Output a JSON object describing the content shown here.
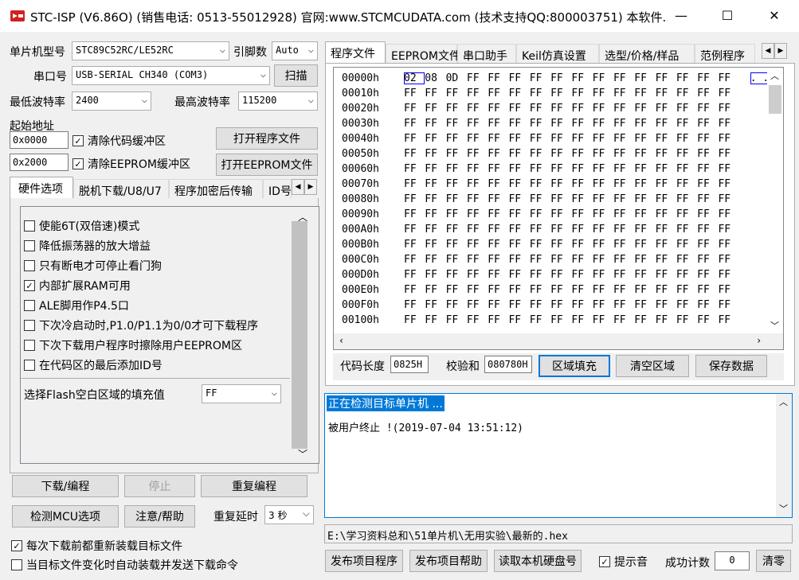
{
  "window": {
    "title": "STC-ISP (V6.86O) (销售电话: 0513-55012928) 官网:www.STCMCUDATA.com  (技术支持QQ:800003751) 本软件...",
    "minimize": "—",
    "maximize": "☐",
    "close": "✕"
  },
  "left": {
    "mcu_label": "单片机型号",
    "mcu_value": "STC89C52RC/LE52RC",
    "pins_label": "引脚数",
    "pins_value": "Auto",
    "port_label": "串口号",
    "port_value": "USB-SERIAL CH340 (COM3)",
    "scan_button": "扫描",
    "min_baud_label": "最低波特率",
    "min_baud_value": "2400",
    "max_baud_label": "最高波特率",
    "max_baud_value": "115200",
    "start_addr_label": "起始地址",
    "code_addr": "0x0000",
    "clear_code_label": "清除代码缓冲区",
    "open_prog_button": "打开程序文件",
    "eeprom_addr": "0x2000",
    "clear_eeprom_label": "清除EEPROM缓冲区",
    "open_eeprom_button": "打开EEPROM文件",
    "tabs": [
      "硬件选项",
      "脱机下载/U8/U7",
      "程序加密后传输",
      "ID号"
    ],
    "options": [
      {
        "label": "使能6T(双倍速)模式",
        "checked": false
      },
      {
        "label": "降低振荡器的放大增益",
        "checked": false
      },
      {
        "label": "只有断电才可停止看门狗",
        "checked": false
      },
      {
        "label": "内部扩展RAM可用",
        "checked": true
      },
      {
        "label": "ALE脚用作P4.5口",
        "checked": false
      },
      {
        "label": "下次冷启动时,P1.0/P1.1为0/0才可下载程序",
        "checked": false
      },
      {
        "label": "下次下载用户程序时擦除用户EEPROM区",
        "checked": false
      },
      {
        "label": "在代码区的最后添加ID号",
        "checked": false
      }
    ],
    "fill_label": "选择Flash空白区域的填充值",
    "fill_value": "FF",
    "download_button": "下载/编程",
    "stop_button": "停止",
    "reprogram_button": "重复编程",
    "check_mcu_button": "检测MCU选项",
    "help_button": "注意/帮助",
    "repeat_delay_label": "重复延时",
    "repeat_delay_value": "3 秒",
    "reload_label": "每次下载前都重新装载目标文件",
    "reload_checked": true,
    "auto_label": "当目标文件变化时自动装载并发送下载命令",
    "auto_checked": false
  },
  "right": {
    "tabs": [
      "程序文件",
      "EEPROM文件",
      "串口助手",
      "Keil仿真设置",
      "选型/价格/样品",
      "范例程序"
    ],
    "hex_rows": [
      {
        "addr": "00000h",
        "bytes": [
          "02",
          "08",
          "0D",
          "FF",
          "FF",
          "FF",
          "FF",
          "FF",
          "FF",
          "FF",
          "FF",
          "FF",
          "FF",
          "FF",
          "FF",
          "FF"
        ],
        "ascii": ". ."
      },
      {
        "addr": "00010h",
        "bytes": [
          "FF",
          "FF",
          "FF",
          "FF",
          "FF",
          "FF",
          "FF",
          "FF",
          "FF",
          "FF",
          "FF",
          "FF",
          "FF",
          "FF",
          "FF",
          "FF"
        ]
      },
      {
        "addr": "00020h",
        "bytes": [
          "FF",
          "FF",
          "FF",
          "FF",
          "FF",
          "FF",
          "FF",
          "FF",
          "FF",
          "FF",
          "FF",
          "FF",
          "FF",
          "FF",
          "FF",
          "FF"
        ]
      },
      {
        "addr": "00030h",
        "bytes": [
          "FF",
          "FF",
          "FF",
          "FF",
          "FF",
          "FF",
          "FF",
          "FF",
          "FF",
          "FF",
          "FF",
          "FF",
          "FF",
          "FF",
          "FF",
          "FF"
        ]
      },
      {
        "addr": "00040h",
        "bytes": [
          "FF",
          "FF",
          "FF",
          "FF",
          "FF",
          "FF",
          "FF",
          "FF",
          "FF",
          "FF",
          "FF",
          "FF",
          "FF",
          "FF",
          "FF",
          "FF"
        ]
      },
      {
        "addr": "00050h",
        "bytes": [
          "FF",
          "FF",
          "FF",
          "FF",
          "FF",
          "FF",
          "FF",
          "FF",
          "FF",
          "FF",
          "FF",
          "FF",
          "FF",
          "FF",
          "FF",
          "FF"
        ]
      },
      {
        "addr": "00060h",
        "bytes": [
          "FF",
          "FF",
          "FF",
          "FF",
          "FF",
          "FF",
          "FF",
          "FF",
          "FF",
          "FF",
          "FF",
          "FF",
          "FF",
          "FF",
          "FF",
          "FF"
        ]
      },
      {
        "addr": "00070h",
        "bytes": [
          "FF",
          "FF",
          "FF",
          "FF",
          "FF",
          "FF",
          "FF",
          "FF",
          "FF",
          "FF",
          "FF",
          "FF",
          "FF",
          "FF",
          "FF",
          "FF"
        ]
      },
      {
        "addr": "00080h",
        "bytes": [
          "FF",
          "FF",
          "FF",
          "FF",
          "FF",
          "FF",
          "FF",
          "FF",
          "FF",
          "FF",
          "FF",
          "FF",
          "FF",
          "FF",
          "FF",
          "FF"
        ]
      },
      {
        "addr": "00090h",
        "bytes": [
          "FF",
          "FF",
          "FF",
          "FF",
          "FF",
          "FF",
          "FF",
          "FF",
          "FF",
          "FF",
          "FF",
          "FF",
          "FF",
          "FF",
          "FF",
          "FF"
        ]
      },
      {
        "addr": "000A0h",
        "bytes": [
          "FF",
          "FF",
          "FF",
          "FF",
          "FF",
          "FF",
          "FF",
          "FF",
          "FF",
          "FF",
          "FF",
          "FF",
          "FF",
          "FF",
          "FF",
          "FF"
        ]
      },
      {
        "addr": "000B0h",
        "bytes": [
          "FF",
          "FF",
          "FF",
          "FF",
          "FF",
          "FF",
          "FF",
          "FF",
          "FF",
          "FF",
          "FF",
          "FF",
          "FF",
          "FF",
          "FF",
          "FF"
        ]
      },
      {
        "addr": "000C0h",
        "bytes": [
          "FF",
          "FF",
          "FF",
          "FF",
          "FF",
          "FF",
          "FF",
          "FF",
          "FF",
          "FF",
          "FF",
          "FF",
          "FF",
          "FF",
          "FF",
          "FF"
        ]
      },
      {
        "addr": "000D0h",
        "bytes": [
          "FF",
          "FF",
          "FF",
          "FF",
          "FF",
          "FF",
          "FF",
          "FF",
          "FF",
          "FF",
          "FF",
          "FF",
          "FF",
          "FF",
          "FF",
          "FF"
        ]
      },
      {
        "addr": "000E0h",
        "bytes": [
          "FF",
          "FF",
          "FF",
          "FF",
          "FF",
          "FF",
          "FF",
          "FF",
          "FF",
          "FF",
          "FF",
          "FF",
          "FF",
          "FF",
          "FF",
          "FF"
        ]
      },
      {
        "addr": "000F0h",
        "bytes": [
          "FF",
          "FF",
          "FF",
          "FF",
          "FF",
          "FF",
          "FF",
          "FF",
          "FF",
          "FF",
          "FF",
          "FF",
          "FF",
          "FF",
          "FF",
          "FF"
        ]
      },
      {
        "addr": "00100h",
        "bytes": [
          "FF",
          "FF",
          "FF",
          "FF",
          "FF",
          "FF",
          "FF",
          "FF",
          "FF",
          "FF",
          "FF",
          "FF",
          "FF",
          "FF",
          "FF",
          "FF"
        ]
      }
    ],
    "code_len_label": "代码长度",
    "code_len_value": "0825H",
    "checksum_label": "校验和",
    "checksum_value": "080780H",
    "fill_button": "区域填充",
    "clear_button": "清空区域",
    "save_button": "保存数据",
    "log_line1": "正在检测目标单片机 ...",
    "log_line2": "被用户终止 !(2019-07-04 13:51:12)",
    "file_path": "E:\\学习资料总和\\51单片机\\无用实验\\最新的.hex",
    "publish_prog_button": "发布项目程序",
    "publish_help_button": "发布项目帮助",
    "read_disk_button": "读取本机硬盘号",
    "sound_label": "提示音",
    "sound_checked": true,
    "success_label": "成功计数",
    "success_value": "0",
    "reset_button": "清零"
  }
}
